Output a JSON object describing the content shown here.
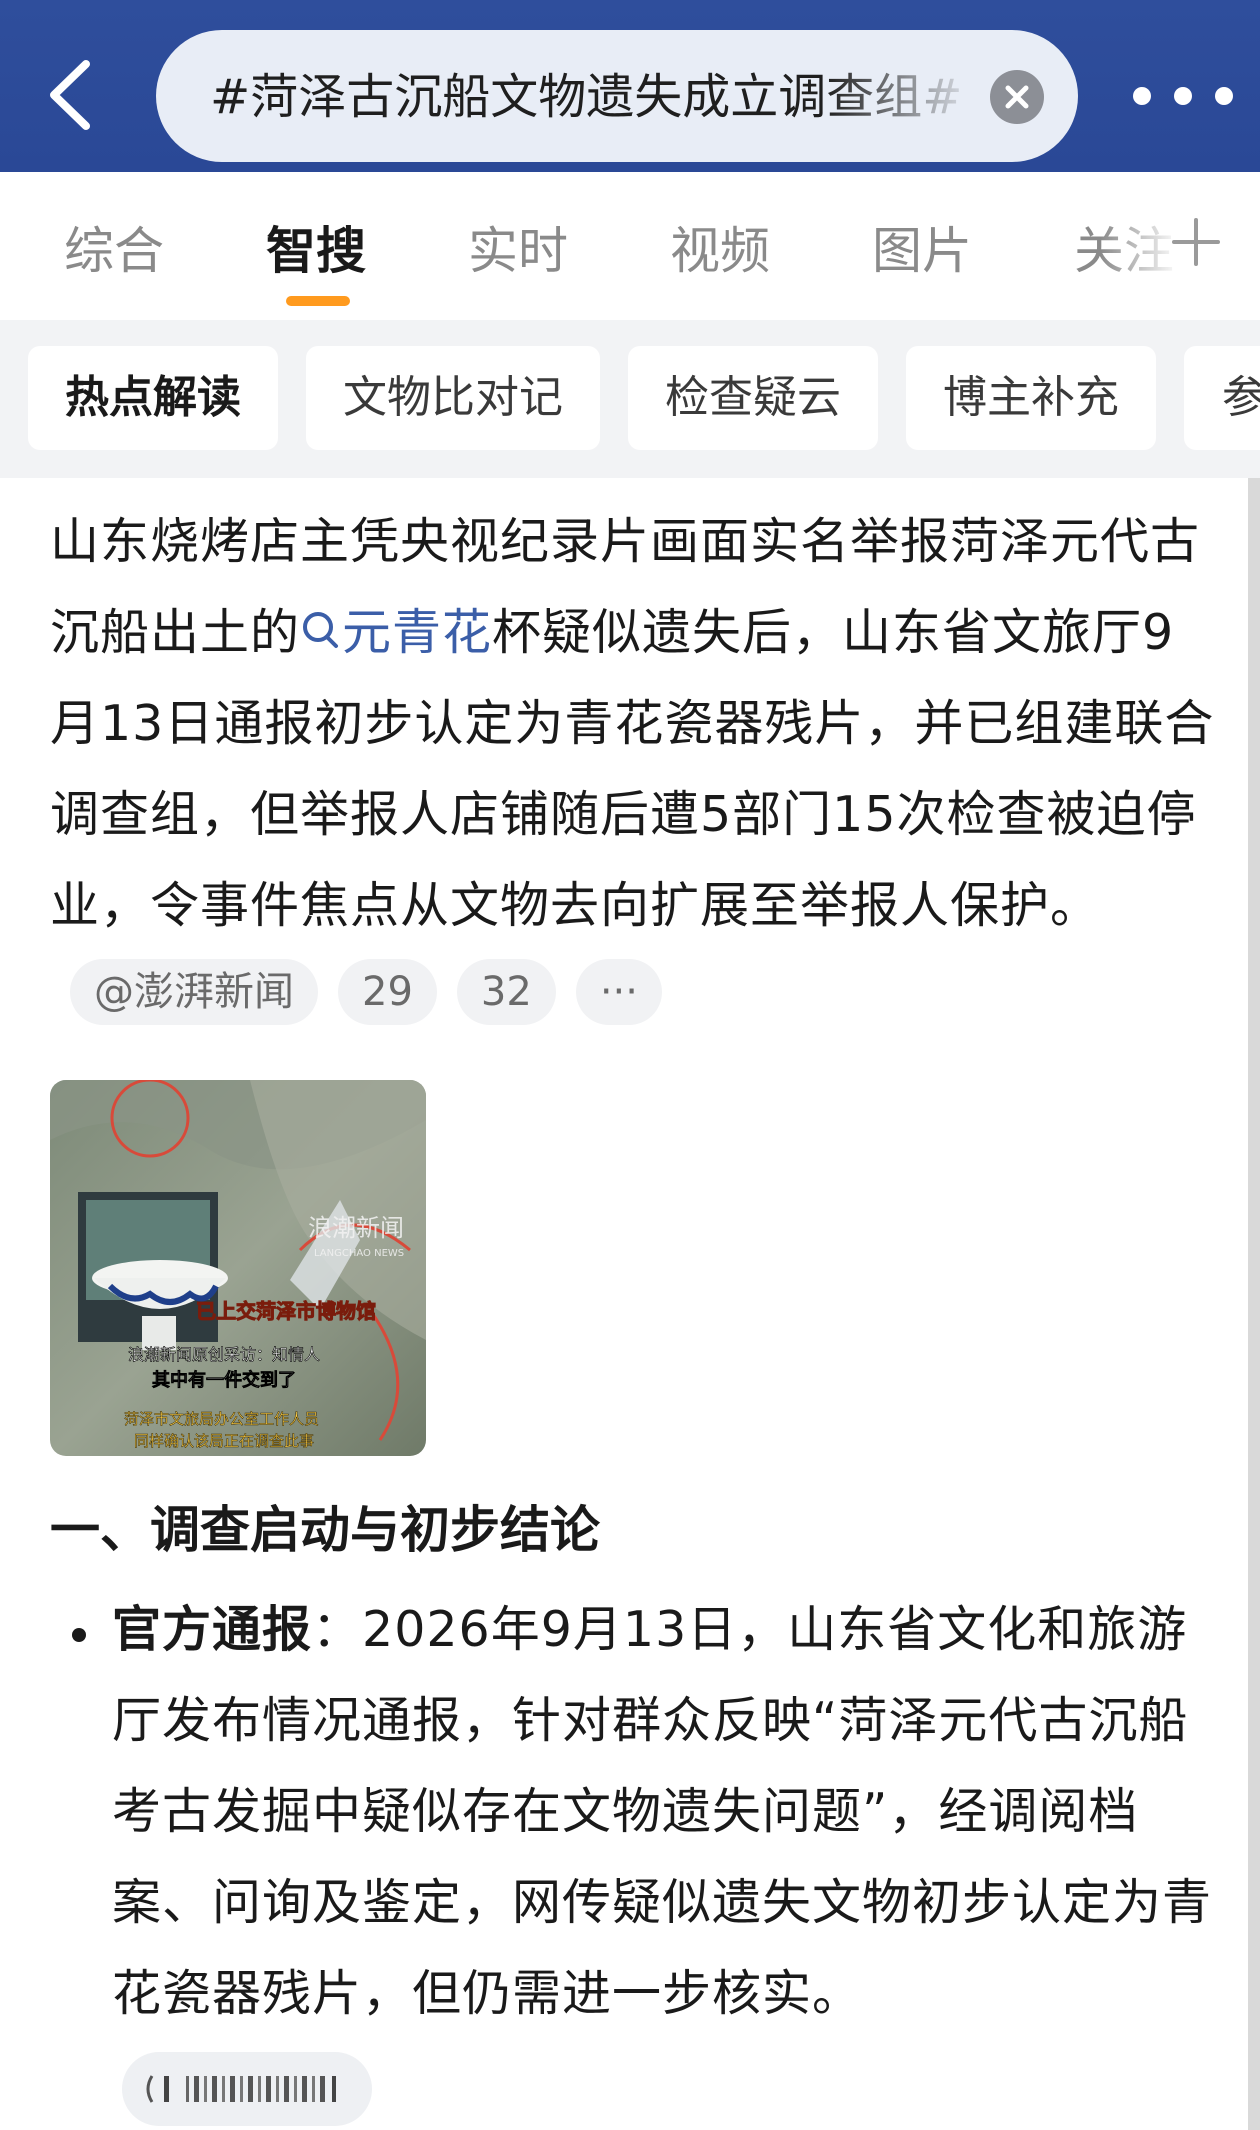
{
  "search": {
    "query": "#菏泽古沉船文物遗失成立调查组#"
  },
  "tabs": [
    {
      "label": "综合"
    },
    {
      "label": "智搜"
    },
    {
      "label": "实时"
    },
    {
      "label": "视频"
    },
    {
      "label": "图片"
    },
    {
      "label": "关注"
    }
  ],
  "chips": [
    {
      "label": "热点解读"
    },
    {
      "label": "文物比对记"
    },
    {
      "label": "检查疑云"
    },
    {
      "label": "博主补充"
    },
    {
      "label": "参考"
    }
  ],
  "article": {
    "intro_before_link": "山东烧烤店主凭央视纪录片画面实名举报菏泽元代古沉船出土的",
    "link_text": "元青花",
    "intro_after_link": "杯疑似遗失后，山东省文旅厅9月13日通报初步认定为青花瓷器残片，并已组建联合调查组，但举报人店铺随后遭5部门15次检查被迫停业，令事件焦点从文物去向扩展至举报人保护。",
    "source_label": "@澎湃新闻",
    "ref_count_1": "29",
    "ref_count_2": "32",
    "more_label": "···",
    "section_heading": "一、调查启动与初步结论",
    "bullet_label": "官方通报",
    "bullet_text": "：2026年9月13日，山东省文化和旅游厅发布情况通报，针对群众反映“菏泽元代古沉船考古发掘中疑似存在文物遗失问题”，经调阅档案、问询及鉴定，网传疑似遗失文物初步认定为青花瓷器残片，但仍需进一步核实。"
  },
  "thumbnail": {
    "watermark_cn": "浪潮新闻",
    "watermark_en": "LANGCHAO NEWS",
    "caption_orange": "已上交菏泽市博物馆",
    "caption_line1": "浪潮新闻原创采访：知情人",
    "caption_line2": "其中有一件交到了",
    "caption_line3": "菏泽市文旅局办公室工作人员",
    "caption_line4": "同样确认该局正在调查此事"
  },
  "colors": {
    "header_bg": "#2f4e9c",
    "accent_orange": "#ff9a1e",
    "link_blue": "#3b5ea8",
    "chip_bg": "#f2f3f5"
  }
}
